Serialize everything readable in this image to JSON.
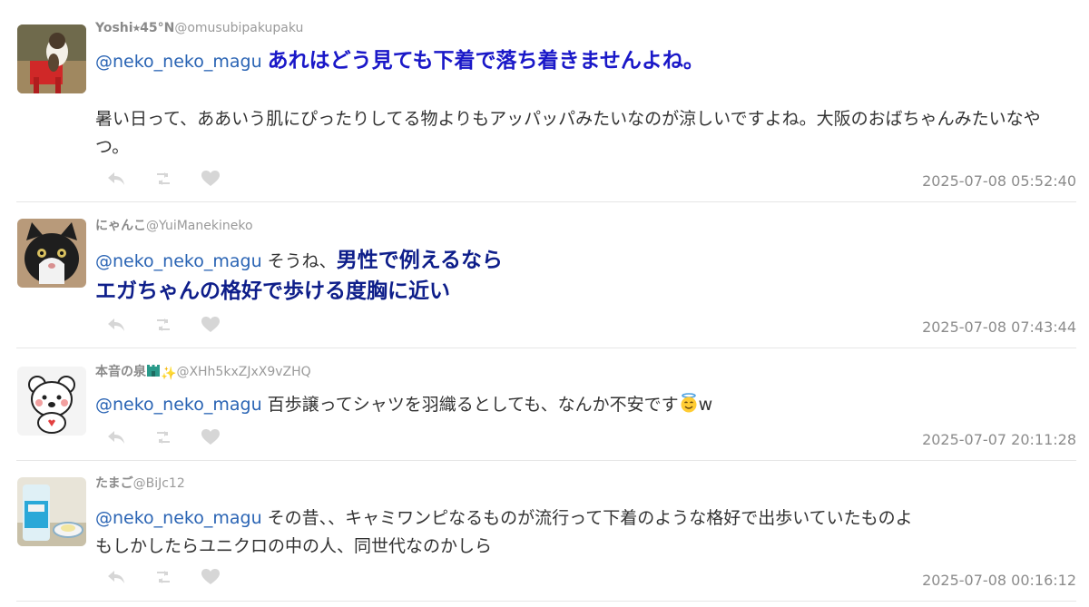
{
  "replies": [
    {
      "name": "Yoshi⭑45°N",
      "handle": "@omusubipakupaku",
      "mention": "@neko_neko_magu",
      "highlight": "あれはどう見ても下着で落ち着きませんよね。",
      "body": "暑い日って、ああいう肌にぴったりしてる物よりもアッパッパみたいなのが涼しいですよね。大阪のおばちゃんみたいなやつ。",
      "timestamp": "2025-07-08 05:52:40"
    },
    {
      "name": "にゃんこ",
      "handle": "@YuiManekineko",
      "mention": "@neko_neko_magu",
      "plain": "そうね、",
      "highlight_line1": "男性で例えるなら",
      "highlight_line2": "エガちゃんの格好で歩ける度胸に近い",
      "timestamp": "2025-07-08 07:43:44"
    },
    {
      "name": "本音の泉",
      "name_emoji": "✨",
      "handle": "@XHh5kxZJxX9vZHQ",
      "mention": "@neko_neko_magu",
      "body": "百歩譲ってシャツを羽織るとしても、なんか不安です",
      "body_suffix": "w",
      "timestamp": "2025-07-07 20:11:28"
    },
    {
      "name": "たまご",
      "handle": "@BiJc12",
      "mention": "@neko_neko_magu",
      "body_line1": "その昔、、キャミワンピなるものが流行って下着のような格好で出歩いていたものよ",
      "body_line2": "もしかしたらユニクロの中の人、同世代なのかしら",
      "timestamp": "2025-07-08 00:16:12"
    }
  ],
  "icons": [
    "reply-icon",
    "retweet-icon",
    "like-icon"
  ],
  "colors": {
    "mention": "#2a64b4",
    "highlight_blue": "#1a18c8",
    "highlight_navy": "#0e1e8a",
    "muted": "#8c8c8c"
  }
}
